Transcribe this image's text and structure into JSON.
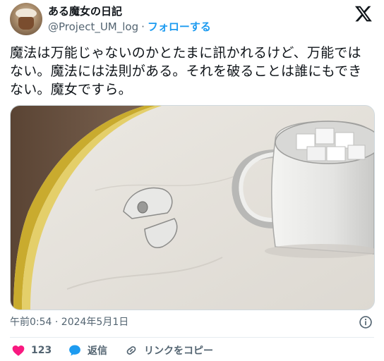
{
  "user": {
    "display_name": "ある魔女の日記",
    "handle": "@Project_UM_log",
    "separator": "·",
    "follow_label": "フォローする"
  },
  "tweet": {
    "text": "魔法は万能じゃないのかとたまに訊かれるけど、万能ではない。魔法には法則がある。それを破ることは誰にもできない。魔女ですら。"
  },
  "meta": {
    "timestamp": "午前0:54 · 2024年5月1日"
  },
  "actions": {
    "like_count": "123",
    "reply_label": "返信",
    "copy_link_label": "リンクをコピー"
  },
  "colors": {
    "accent": "#1d9bf0",
    "like": "#f91880",
    "secondary_text": "#536471"
  },
  "icons": {
    "brand": "x-logo-icon",
    "info": "info-icon",
    "like": "heart-icon",
    "reply": "speech-bubble-icon",
    "copy_link": "link-icon"
  }
}
